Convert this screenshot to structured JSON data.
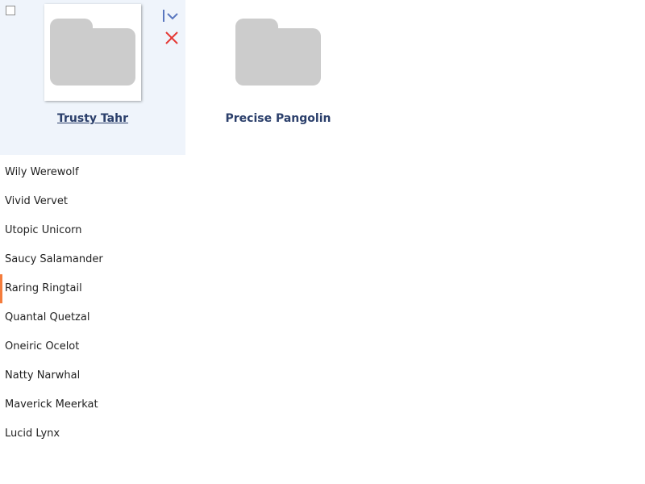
{
  "folders": [
    {
      "label": "Trusty Tahr",
      "selected": true,
      "icon": "folder-icon"
    },
    {
      "label": "Precise Pangolin",
      "selected": false,
      "icon": "folder-icon"
    }
  ],
  "tile_actions": {
    "dropdown_icon": "chevron-down-icon",
    "remove_icon": "close-icon"
  },
  "list": {
    "items": [
      {
        "label": "Wily Werewolf"
      },
      {
        "label": "Vivid Vervet"
      },
      {
        "label": "Utopic Unicorn"
      },
      {
        "label": "Saucy Salamander"
      },
      {
        "label": "Raring Ringtail",
        "active": true
      },
      {
        "label": "Quantal Quetzal"
      },
      {
        "label": "Oneiric Ocelot"
      },
      {
        "label": "Natty Narwhal"
      },
      {
        "label": "Maverick Meerkat"
      },
      {
        "label": "Lucid Lynx"
      }
    ]
  },
  "colors": {
    "selected_tile_bg": "#eff4fb",
    "folder_gray": "#cccccc",
    "label_blue": "#2b3f6b",
    "chevron_blue": "#5a77bf",
    "close_red": "#e53935",
    "active_indicator": "#f47c3c"
  }
}
